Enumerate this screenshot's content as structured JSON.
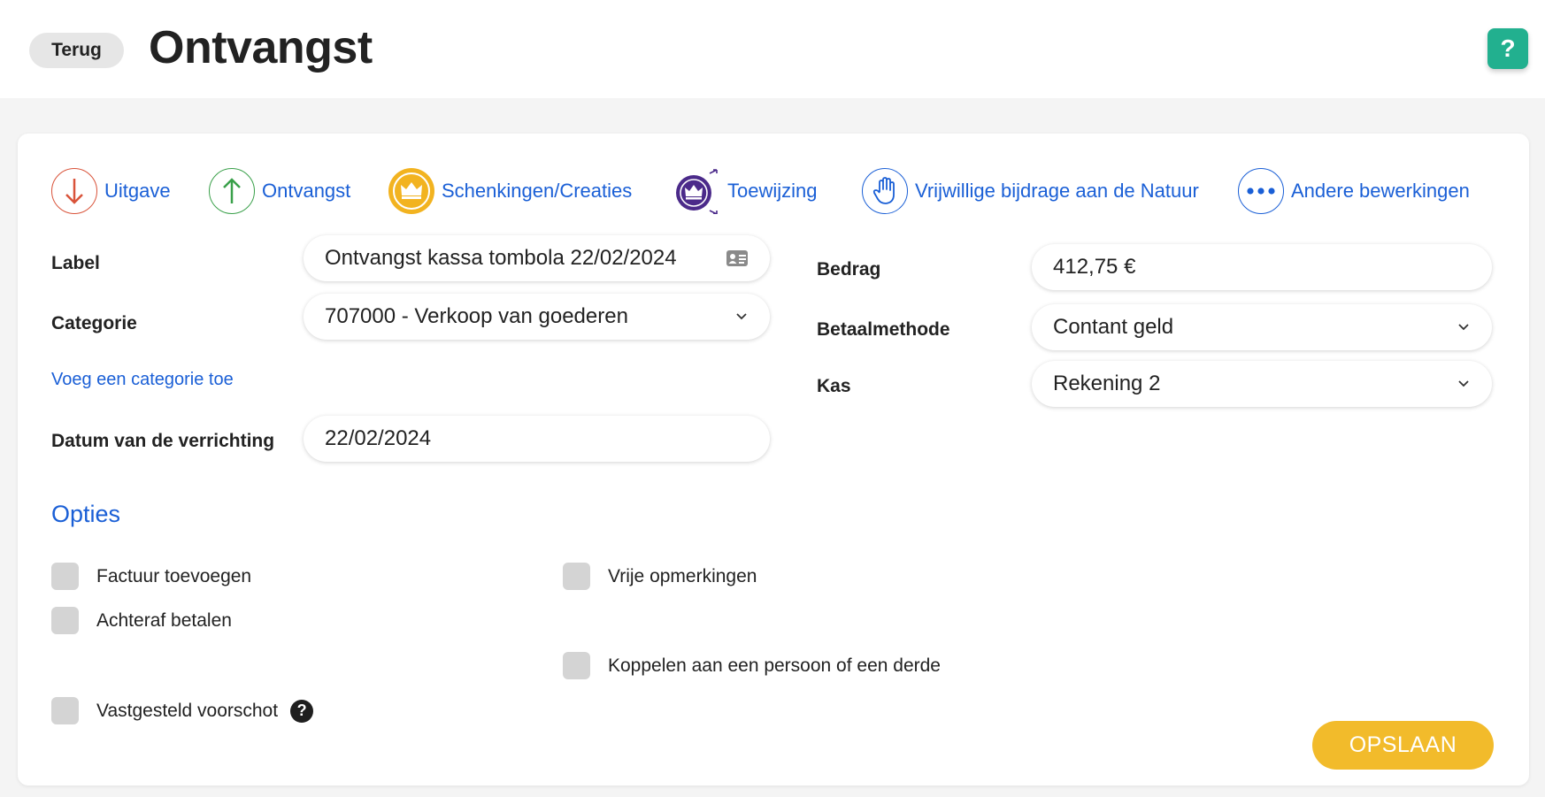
{
  "header": {
    "back_label": "Terug",
    "title": "Ontvangst",
    "help_label": "?"
  },
  "operations": [
    {
      "label": "Uitgave",
      "icon": "arrow-down-icon",
      "color": "#d9533a"
    },
    {
      "label": "Ontvangst",
      "icon": "arrow-up-icon",
      "color": "#3aa04a"
    },
    {
      "label": "Schenkingen/Creaties",
      "icon": "crown-icon",
      "color": "#f2b320"
    },
    {
      "label": "Toewijzing",
      "icon": "crown-expand-icon",
      "color": "#4b2a8a"
    },
    {
      "label": "Vrijwillige bijdrage aan de Natuur",
      "icon": "hand-icon",
      "color": "#1a5fd6"
    },
    {
      "label": "Andere bewerkingen",
      "icon": "more-icon",
      "color": "#1a5fd6"
    }
  ],
  "form": {
    "label": {
      "label": "Label",
      "value": "Ontvangst kassa tombola 22/02/2024"
    },
    "category": {
      "label": "Categorie",
      "value": "707000 - Verkoop van goederen"
    },
    "add_category_link": "Voeg een categorie toe",
    "date": {
      "label": "Datum van de verrichting",
      "value": "22/02/2024"
    },
    "amount": {
      "label": "Bedrag",
      "value": "412,75 €"
    },
    "payment_method": {
      "label": "Betaalmethode",
      "value": "Contant geld"
    },
    "cash": {
      "label": "Kas",
      "value": "Rekening 2"
    }
  },
  "options": {
    "title": "Opties",
    "items": [
      {
        "label": "Factuur toevoegen",
        "checked": false
      },
      {
        "label": "Vrije opmerkingen",
        "checked": false
      },
      {
        "label": "Achteraf betalen",
        "checked": false
      },
      {
        "label": "Koppelen aan een persoon of een derde",
        "checked": false
      },
      {
        "label": "Vastgesteld voorschot",
        "checked": false
      }
    ],
    "help_label": "?"
  },
  "actions": {
    "save_label": "OPSLAAN"
  },
  "colors": {
    "accent": "#1a5fd6",
    "save": "#f2bb2b",
    "help": "#22b08f"
  }
}
